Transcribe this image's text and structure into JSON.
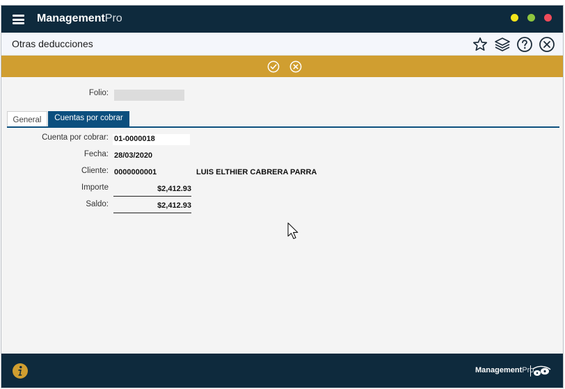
{
  "app": {
    "brand_bold": "Management",
    "brand_light": "Pro"
  },
  "header": {
    "title": "Otras deducciones"
  },
  "form": {
    "folio_label": "Folio:",
    "folio_value": ""
  },
  "tabs": [
    {
      "label": "General",
      "active": false
    },
    {
      "label": "Cuentas por cobrar",
      "active": true
    }
  ],
  "cuenta": {
    "cuenta_label": "Cuenta por cobrar:",
    "cuenta_value": "01-0000018",
    "fecha_label": "Fecha:",
    "fecha_value": "28/03/2020",
    "cliente_label": "Cliente:",
    "cliente_id": "0000000001",
    "cliente_name": "LUIS ELTHIER CABRERA PARRA",
    "importe_label": "Importe",
    "importe_value": "$2,412.93",
    "saldo_label": "Saldo:",
    "saldo_value": "$2,412.93"
  },
  "footer": {
    "brand_bold": "Management",
    "brand_light": "Pro"
  },
  "colors": {
    "titlebar": "#0e2a3d",
    "actionbar": "#d09e30",
    "tab_active": "#0c4f7e"
  },
  "icons": {
    "menu": "hamburger-menu-icon",
    "favorite": "star-icon",
    "layers": "layers-icon",
    "help": "help-icon",
    "close": "close-circle-icon",
    "confirm": "check-circle-icon",
    "cancel": "cancel-circle-icon",
    "info": "info-icon"
  }
}
